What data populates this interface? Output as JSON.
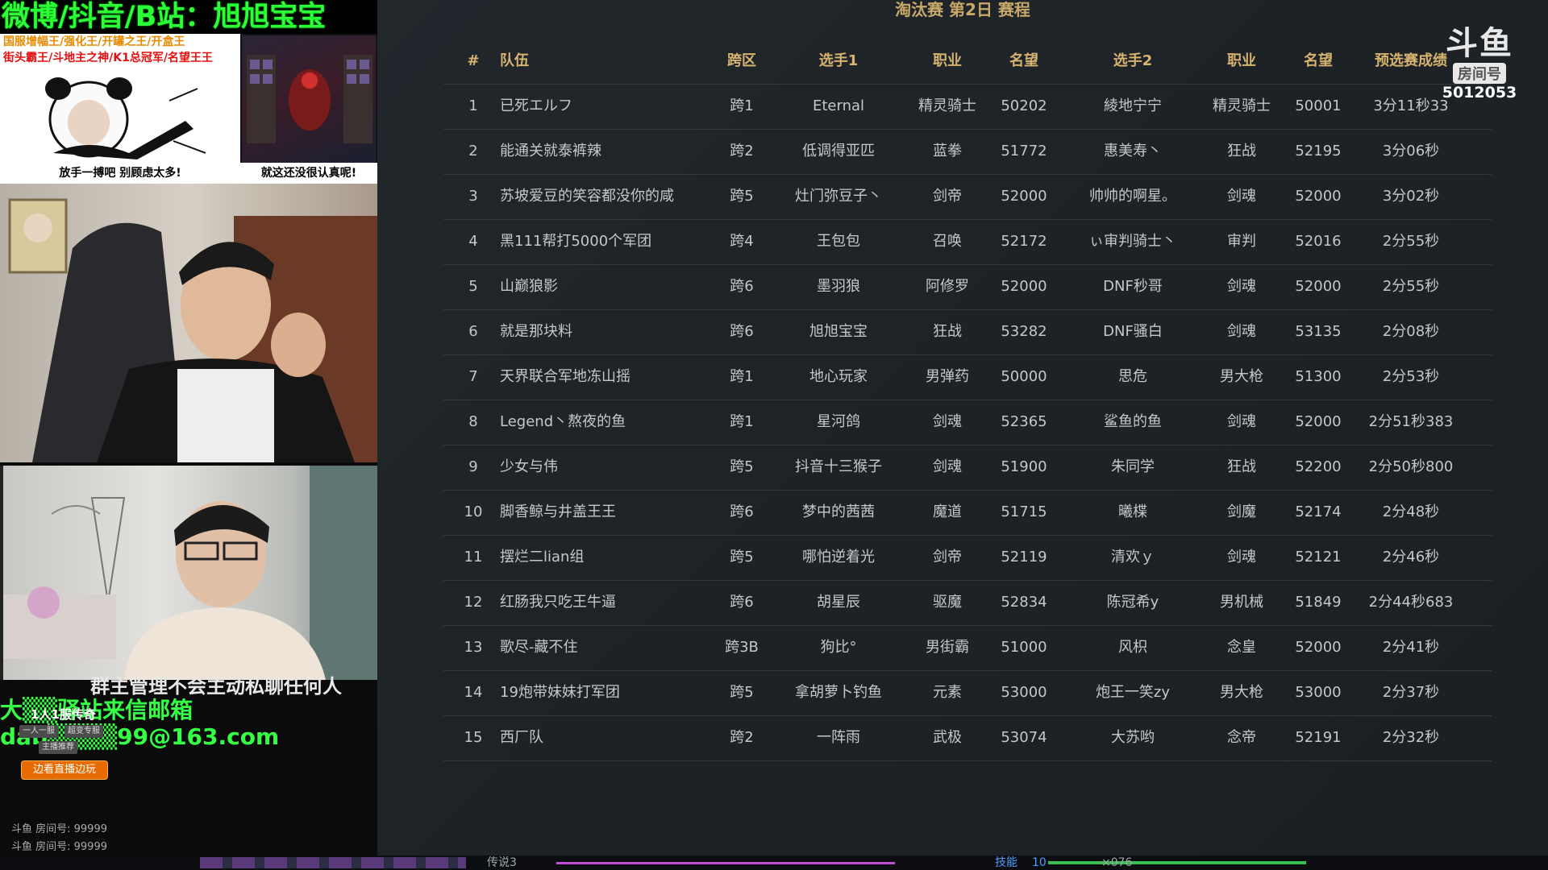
{
  "left": {
    "banner": "微博/抖音/B站：旭旭宝宝",
    "promo_line1": "国服增幅王/强化王/开罐之王/开盒王",
    "promo_line2": "街头霸王/斗地主之神/K1总冠军/名望王王",
    "meme_caption": "放手一搏吧 别顾虑太多!",
    "game_caption": "就这还没很认真呢!",
    "overlay_line1": "群主管理不会主动私聊任何人",
    "overlay_line2": "大▒▒驿站来信邮箱",
    "overlay_line3": "dab▒▒▒▒99@163.com",
    "badge_name": "1人1服传奇",
    "badge_tag1": "一人一服",
    "badge_tag2": "超变专服",
    "badge_tag3": "主播推荐",
    "badge_button": "边看直播边玩",
    "room_line1": "斗鱼 房间号: 99999",
    "room_line2": "斗鱼 房间号: 99999"
  },
  "table": {
    "title": "淘汰赛 第2日 赛程",
    "headers": {
      "rank": "#",
      "team": "队伍",
      "zone": "跨区",
      "player1": "选手1",
      "job1": "职业",
      "fame1": "名望",
      "player2": "选手2",
      "job2": "职业",
      "fame2": "名望",
      "result": "预选赛成绩"
    },
    "rows": [
      {
        "rank": "1",
        "team": "已死エルフ",
        "zone": "跨1",
        "p1": "Eternal",
        "j1": "精灵骑士",
        "f1": "50202",
        "p2": "綾地宁宁",
        "j2": "精灵骑士",
        "f2": "50001",
        "res": "3分11秒33"
      },
      {
        "rank": "2",
        "team": "能通关就泰裤辣",
        "zone": "跨2",
        "p1": "低调得亚匹",
        "j1": "蓝拳",
        "f1": "51772",
        "p2": "惠美寿丶",
        "j2": "狂战",
        "f2": "52195",
        "res": "3分06秒"
      },
      {
        "rank": "3",
        "team": "苏坡爱豆的笑容都没你的咸",
        "zone": "跨5",
        "p1": "灶门弥豆子丶",
        "j1": "剑帝",
        "f1": "52000",
        "p2": "帅帅的啊星。",
        "j2": "剑魂",
        "f2": "52000",
        "res": "3分02秒"
      },
      {
        "rank": "4",
        "team": "黑111帮打5000个军团",
        "zone": "跨4",
        "p1": "王包包",
        "j1": "召唤",
        "f1": "52172",
        "p2": "ぃ审判骑士丶",
        "j2": "审判",
        "f2": "52016",
        "res": "2分55秒"
      },
      {
        "rank": "5",
        "team": "山巅狼影",
        "zone": "跨6",
        "p1": "墨羽狼",
        "j1": "阿修罗",
        "f1": "52000",
        "p2": "DNF秒哥",
        "j2": "剑魂",
        "f2": "52000",
        "res": "2分55秒"
      },
      {
        "rank": "6",
        "team": "就是那块料",
        "zone": "跨6",
        "p1": "旭旭宝宝",
        "j1": "狂战",
        "f1": "53282",
        "p2": "DNF骚白",
        "j2": "剑魂",
        "f2": "53135",
        "res": "2分08秒"
      },
      {
        "rank": "7",
        "team": "天界联合军地冻山摇",
        "zone": "跨1",
        "p1": "地心玩家",
        "j1": "男弹药",
        "f1": "50000",
        "p2": "思危",
        "j2": "男大枪",
        "f2": "51300",
        "res": "2分53秒"
      },
      {
        "rank": "8",
        "team": "Legend丶熬夜的鱼",
        "zone": "跨1",
        "p1": "星河鸽",
        "j1": "剑魂",
        "f1": "52365",
        "p2": "鲨鱼的鱼",
        "j2": "剑魂",
        "f2": "52000",
        "res": "2分51秒383"
      },
      {
        "rank": "9",
        "team": "少女与伟",
        "zone": "跨5",
        "p1": "抖音十三猴子",
        "j1": "剑魂",
        "f1": "51900",
        "p2": "朱同学",
        "j2": "狂战",
        "f2": "52200",
        "res": "2分50秒800"
      },
      {
        "rank": "10",
        "team": "脚香鲸与井盖王王",
        "zone": "跨6",
        "p1": "梦中的茜茜",
        "j1": "魔道",
        "f1": "51715",
        "p2": "曦楪",
        "j2": "剑魔",
        "f2": "52174",
        "res": "2分48秒"
      },
      {
        "rank": "11",
        "team": "摆烂二lian组",
        "zone": "跨5",
        "p1": "哪怕逆着光",
        "j1": "剑帝",
        "f1": "52119",
        "p2": "清欢ｙ",
        "j2": "剑魂",
        "f2": "52121",
        "res": "2分46秒"
      },
      {
        "rank": "12",
        "team": "红肠我只吃王牛逼",
        "zone": "跨6",
        "p1": "胡星辰",
        "j1": "驱魔",
        "f1": "52834",
        "p2": "陈冠希y",
        "j2": "男机械",
        "f2": "51849",
        "res": "2分44秒683"
      },
      {
        "rank": "13",
        "team": "歌尽-藏不住",
        "zone": "跨3B",
        "p1": "狗比°",
        "j1": "男街霸",
        "f1": "51000",
        "p2": "风枳",
        "j2": "念皇",
        "f2": "52000",
        "res": "2分41秒"
      },
      {
        "rank": "14",
        "team": "19炮带妹妹打军团",
        "zone": "跨5",
        "p1": "拿胡萝卜钓鱼",
        "j1": "元素",
        "f1": "53000",
        "p2": "炮王一笑zy",
        "j2": "男大枪",
        "f2": "53000",
        "res": "2分37秒"
      },
      {
        "rank": "15",
        "team": "西厂队",
        "zone": "跨2",
        "p1": "一阵雨",
        "j1": "武极",
        "f1": "53074",
        "p2": "大苏哟",
        "j2": "念帝",
        "f2": "52191",
        "res": "2分32秒"
      }
    ]
  },
  "logo": {
    "mark": "斗鱼",
    "room_label": "房间号",
    "room_number": "5012053"
  },
  "bottom_bar": {
    "label1": "传说3",
    "label2": "技能",
    "label2_value": "10",
    "label3": "×076"
  },
  "colors": {
    "header_gold": "#d6b36f",
    "banner_green": "#2bff38",
    "promo_orange": "#e78a00",
    "promo_red": "#e21010"
  }
}
